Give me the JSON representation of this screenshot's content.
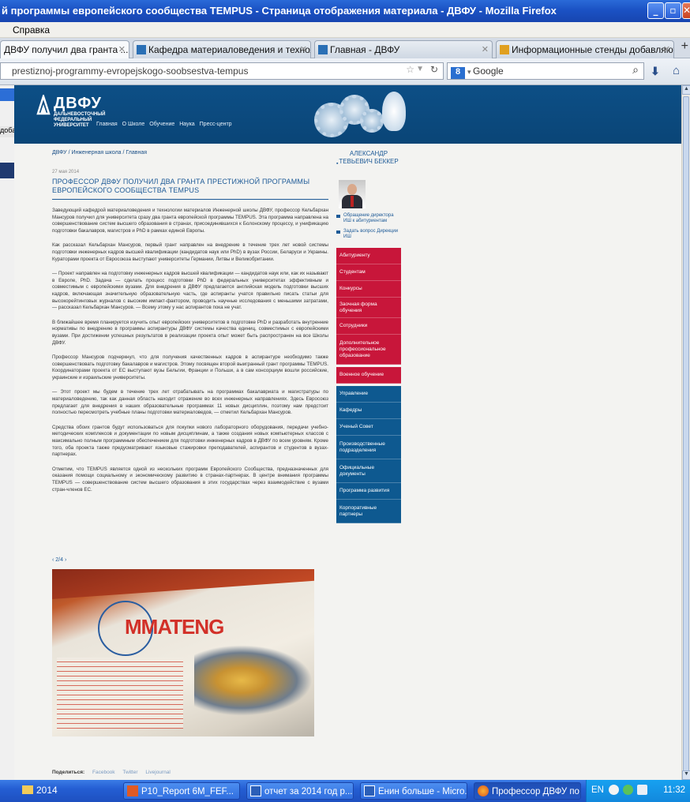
{
  "window": {
    "title": "й программы европейского сообщества TEMPUS - Страница отображения материала - ДВФУ - Mozilla Firefox"
  },
  "menubar": {
    "items": [
      "Справка"
    ]
  },
  "tabs": [
    {
      "label": "ДВФУ получил два гранта ...",
      "active": true
    },
    {
      "label": "Кафедра материаловедения и технол...",
      "active": false
    },
    {
      "label": "Главная - ДВФУ",
      "active": false
    },
    {
      "label": "Информационные стенды добавляют ...",
      "active": false
    }
  ],
  "nav": {
    "url": "prestiznoj-programmy-evropejskogo-soobsestva-tempus",
    "search_placeholder": "Google"
  },
  "left_stub": {
    "label": "доба"
  },
  "site": {
    "logo": {
      "name": "ДВФУ",
      "sub": "ДАЛЬНЕВОСТОЧНЫЙ ФЕДЕРАЛЬНЫЙ УНИВЕРСИТЕТ"
    },
    "nav_items": [
      "Главная",
      "О Школе",
      "Обучение",
      "Наука",
      "Пресс-центр"
    ]
  },
  "article": {
    "breadcrumb": "ДВФУ / Инженерная школа / Главная",
    "date": "27 мая 2014",
    "headline": "ПРОФЕССОР ДВФУ ПОЛУЧИЛ ДВА ГРАНТА ПРЕСТИЖНОЙ ПРОГРАММЫ ЕВРОПЕЙСКОГО СООБЩЕСТВА TEMPUS",
    "paragraphs": [
      "Заведующий кафедрой материаловедения и технологии материалов Инженерной школы ДВФУ, профессор Кельбархан Мансуров получил для университета сразу два гранта европейской программы TEMPUS. Эта программа направлена на совершенствование систем высшего образования в странах, присоединившихся к Болонскому процессу, и унификацию подготовки бакалавров, магистров и PhD в рамках единой Европы.",
      "Как рассказал Кельбархан Мансуров, первый грант направлен на внедрение в течение трех лет новой системы подготовки инженерных кадров высшей квалификации (кандидатов наук или PhD) в вузах России, Беларуси и Украины. Кураторами проекта от Евросоюза выступают университеты Германии, Литвы и Великобритании.",
      "— Проект направлен на подготовку инженерных кадров высшей квалификации — кандидатов наук или, как их называют в Европе, PhD. Задача — сделать процесс подготовки PhD в федеральных университетах эффективным и совместимым с европейскими вузами. Для внедрения в ДВФУ предлагается английская модель подготовки высших кадров, включающая значительную образовательную часть, где аспиранты учатся правильно писать статьи для высокорейтинговых журналов с высоким импакт-фактором, проводить научные исследования с меньшими затратами, — рассказал Кельбархан Мансуров. — Всему этому у нас аспирантов пока не учат.",
      "В ближайшее время планируется изучить опыт европейских университетов в подготовке PhD и разработать внутренние нормативы по внедрению в программы аспирантуры ДВФУ системы качества единиц, совместимых с европейскими вузами. При достижении успешных результатов в реализации проекта опыт может быть распространен на все Школы ДВФУ.",
      "Профессор Мансуров подчеркнул, что для получения качественных кадров в аспирантуре необходимо также совершенствовать подготовку бакалавров и магистров. Этому посвящен второй выигранный грант программы TEMPUS. Координаторами проекта от ЕС выступают вузы Бельгии, Франции и Польши, а в сам консорциум вошли российские, украинские и израильские университеты.",
      "— Этот проект мы будем в течение трех лет отрабатывать на программах бакалавриата и магистратуры по материаловедению, так как данная область находит отражение во всех инженерных направлениях. Здесь Евросоюз предлагает для внедрения в наших образовательные программах 11 новых дисциплин, поэтому нам предстоит полностью пересмотреть учебные планы подготовки материаловедов, — отметил Кельбархан Мансуров.",
      "Средства обоих грантов будут использоваться для покупки нового лабораторного оборудования, передачи учебно-методических комплексов и документации по новым дисциплинам, а также создания новых компьютерных классов с максимально полным программным обеспечением для подготовки инженерных кадров в ДВФУ по всем уровням. Кроме того, оба проекта также предусматривают языковые стажировки преподавателей, аспирантов и студентов в вузах-партнерах.",
      "Отметим, что TEMPUS является одной из нескольких программ Европейского Сообщества, предназначенных для оказания помощи социальному и экономическому развитию в странах-партнерах. В центре внимания программы TEMPUS — совершенствование систем высшего образования в этих государствах через взаимодействие с вузами стран-членов ЕС."
    ],
    "pager": "‹ 2/4 ›",
    "photo_logo": "MMATENG",
    "share_label": "Поделиться:",
    "share_items": [
      "Facebook",
      "Twitter",
      "Livejournal"
    ]
  },
  "sidebar": {
    "person_name": "АЛЕКСАНДР ТЕВЬЕВИЧ БЕККЕР",
    "links": [
      "Обращение директора ИШ к абитуриентам",
      "Задать вопрос Дирекции ИШ"
    ],
    "menu_red": [
      "Абитуриенту",
      "Студентам",
      "Конкурсы",
      "Заочная форма обучения",
      "Сотрудники",
      "Дополнительное профессиональное образование",
      "Военное обучение"
    ],
    "menu_blue": [
      "Управление",
      "Кафедры",
      "Ученый Совет",
      "Производственные подразделения",
      "Официальные документы",
      "Программа развития",
      "Корпоративные партнеры"
    ]
  },
  "taskbar": {
    "start_label": "2014",
    "buttons": [
      "P10_Report 6M_FEF...",
      "отчет за 2014 год р...",
      "Енин больше - Micro...",
      "Профессор ДВФУ по..."
    ],
    "lang": "EN",
    "clock": "11:32"
  },
  "colors": {
    "titlebar": "#1b52c4",
    "site_header": "#0d4f86",
    "menu_red": "#c8163a",
    "menu_blue": "#0e5990",
    "link": "#1d5a97"
  }
}
